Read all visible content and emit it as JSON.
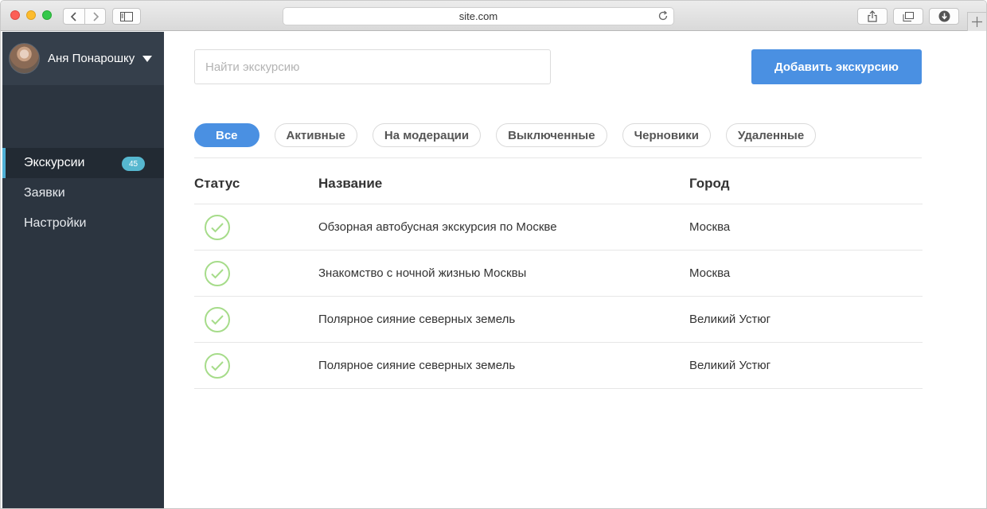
{
  "browser": {
    "url": "site.com"
  },
  "sidebar": {
    "user_name": "Аня Понарошку",
    "items": [
      {
        "label": "Экскурсии",
        "badge": "45",
        "active": true
      },
      {
        "label": "Заявки"
      },
      {
        "label": "Настройки"
      }
    ]
  },
  "main": {
    "search_placeholder": "Найти экскурсию",
    "add_button": "Добавить экскурсию",
    "filters": [
      "Все",
      "Активные",
      "На модерации",
      "Выключенные",
      "Черновики",
      "Удаленные"
    ],
    "table": {
      "headers": {
        "status": "Статус",
        "name": "Название",
        "city": "Город"
      },
      "rows": [
        {
          "name": "Обзорная автобусная экскурсия по Москве",
          "city": "Москва"
        },
        {
          "name": "Знакомство с ночной жизнью Москвы",
          "city": "Москва"
        },
        {
          "name": "Полярное сияние северных земель",
          "city": "Великий Устюг"
        },
        {
          "name": "Полярное сияние северных земель",
          "city": "Великий Устюг"
        }
      ]
    }
  },
  "colors": {
    "accent": "#4a90e2",
    "sidebar_bg": "#2c3540",
    "badge": "#56b7cf",
    "status_ok": "#a6dc8a"
  }
}
